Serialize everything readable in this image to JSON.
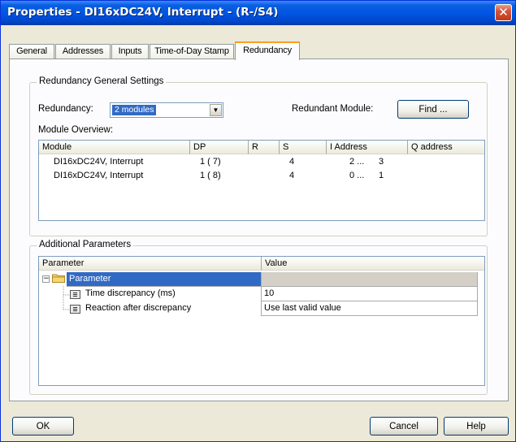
{
  "window": {
    "title": "Properties - DI16xDC24V, Interrupt - (R-/S4)",
    "close_glyph": "✕"
  },
  "tabs": [
    {
      "label": "General"
    },
    {
      "label": "Addresses"
    },
    {
      "label": "Inputs"
    },
    {
      "label": "Time-of-Day Stamp"
    },
    {
      "label": "Redundancy"
    }
  ],
  "active_tab": "Redundancy",
  "redundancy_group": {
    "title": "Redundancy General Settings",
    "redundancy_label": "Redundancy:",
    "redundancy_value": "2 modules",
    "redundant_module_label": "Redundant Module:",
    "find_button": "Find ...",
    "module_overview_label": "Module Overview:",
    "columns": [
      "Module",
      "DP",
      "R",
      "S",
      "I Address",
      "Q address"
    ],
    "rows": [
      {
        "module": "DI16xDC24V, Interrupt",
        "dp": "1 ( 7)",
        "r": "",
        "s": "4",
        "i_address": "2 ...",
        "i_end": "3",
        "q_address": ""
      },
      {
        "module": "DI16xDC24V, Interrupt",
        "dp": "1 ( 8)",
        "r": "",
        "s": "4",
        "i_address": "0 ...",
        "i_end": "1",
        "q_address": ""
      }
    ]
  },
  "additional_group": {
    "title": "Additional Parameters",
    "columns": [
      "Parameter",
      "Value"
    ],
    "root": {
      "label": "Parameter",
      "expander": "−"
    },
    "params": [
      {
        "name": "Time discrepancy (ms)",
        "value": "10"
      },
      {
        "name": "Reaction after discrepancy",
        "value": "Use last valid value"
      }
    ]
  },
  "footer": {
    "ok": "OK",
    "cancel": "Cancel",
    "help": "Help"
  },
  "colors": {
    "titlebar": "#0054e3",
    "selection": "#316ac5",
    "active_tab_accent": "#ff9e1f"
  }
}
